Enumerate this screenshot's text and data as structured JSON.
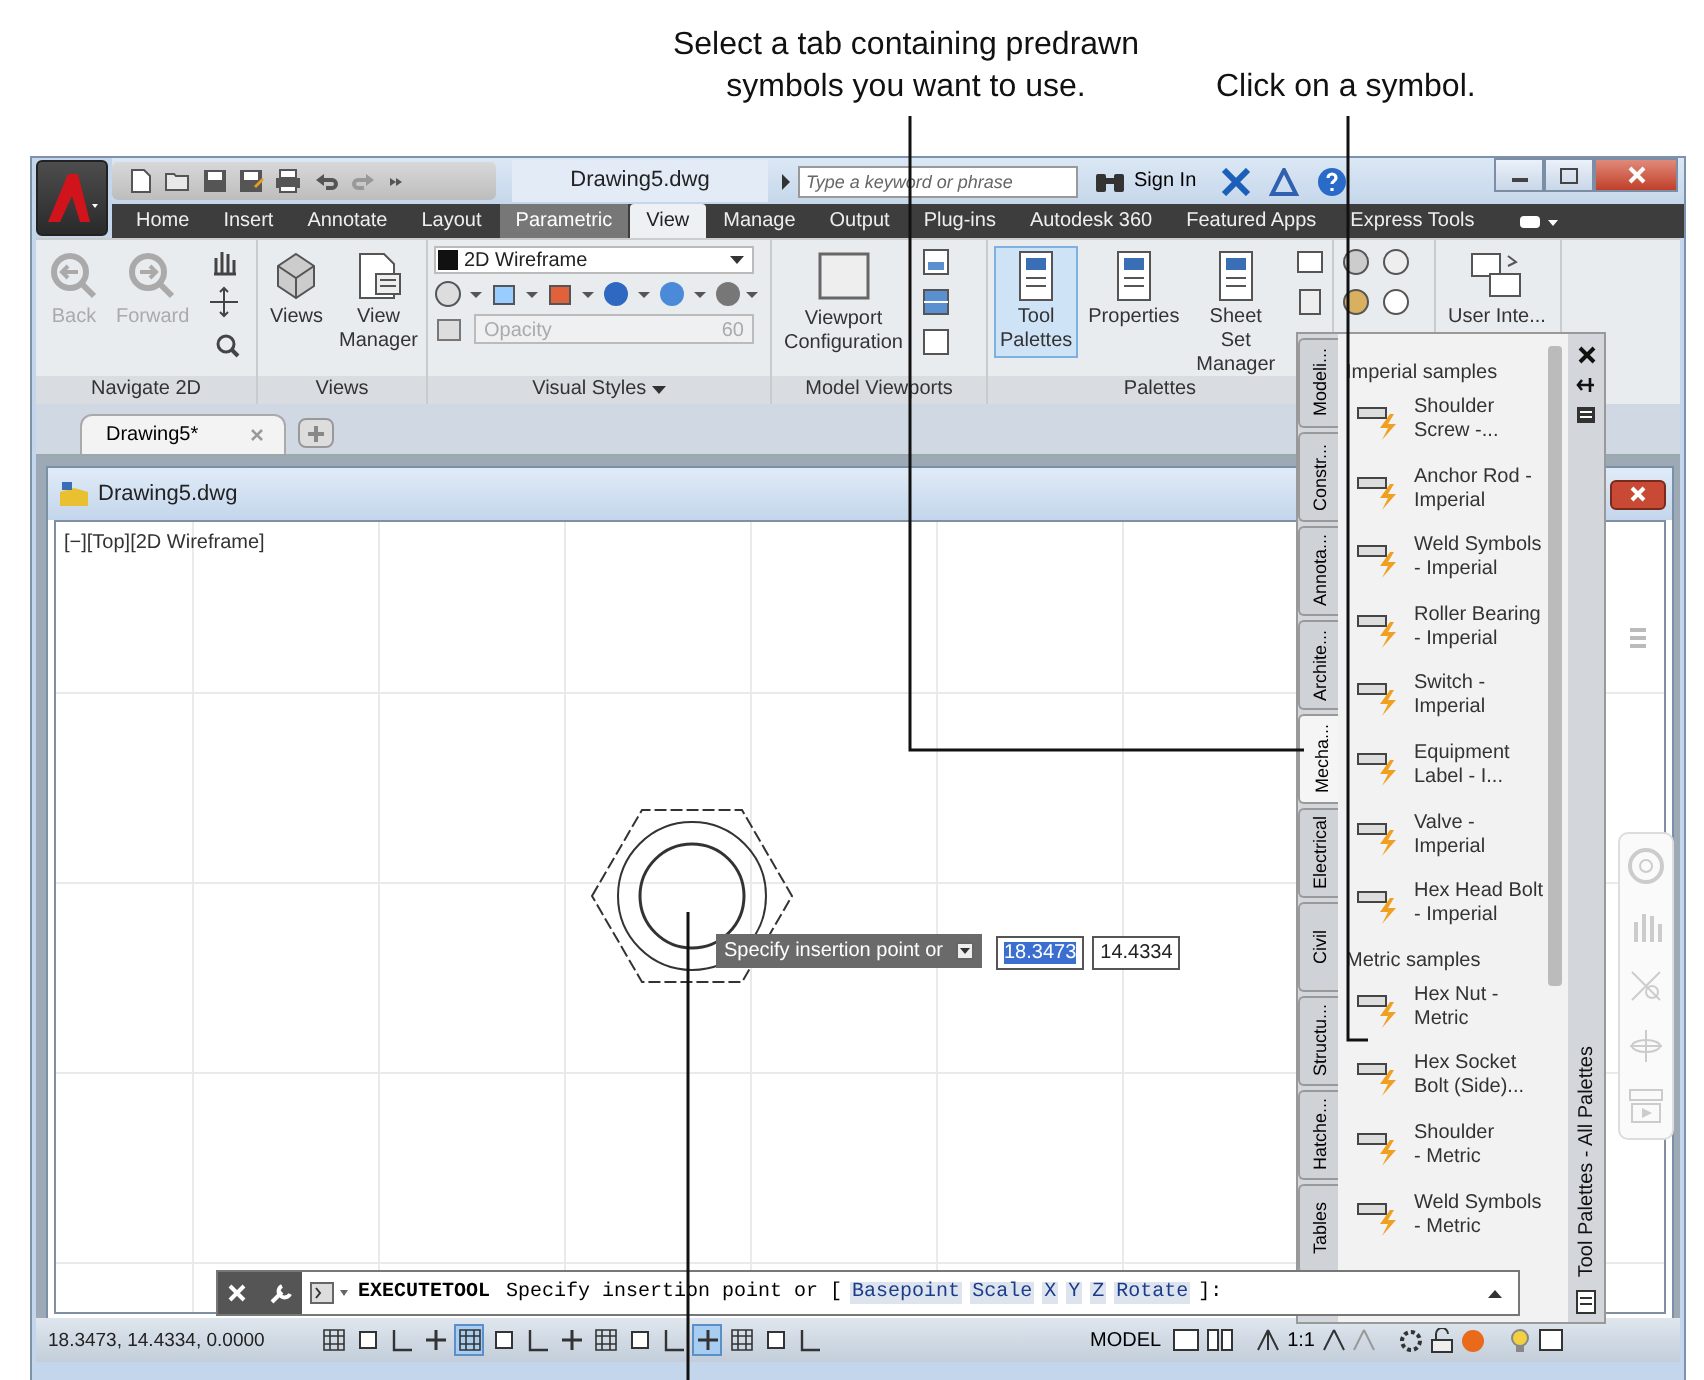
{
  "callouts": [
    {
      "lines": [
        "Select a tab containing predrawn",
        "symbols you want to use."
      ]
    },
    {
      "lines": [
        "Click on a symbol."
      ]
    }
  ],
  "title_bar": {
    "title": "Drawing5.dwg",
    "search": {
      "placeholder": "Type a keyword or phrase"
    },
    "sign_in": "Sign In"
  },
  "ribbon_tabs": [
    {
      "label": "Home",
      "selected": false,
      "hovered": false
    },
    {
      "label": "Insert",
      "selected": false,
      "hovered": false
    },
    {
      "label": "Annotate",
      "selected": false,
      "hovered": false
    },
    {
      "label": "Layout",
      "selected": false,
      "hovered": false
    },
    {
      "label": "Parametric",
      "selected": false,
      "hovered": true
    },
    {
      "label": "View",
      "selected": true,
      "hovered": false
    },
    {
      "label": "Manage",
      "selected": false,
      "hovered": false
    },
    {
      "label": "Output",
      "selected": false,
      "hovered": false
    },
    {
      "label": "Plug-ins",
      "selected": false,
      "hovered": false
    },
    {
      "label": "Autodesk 360",
      "selected": false,
      "hovered": false
    },
    {
      "label": "Featured Apps",
      "selected": false,
      "hovered": false
    },
    {
      "label": "Express Tools",
      "selected": false,
      "hovered": false
    }
  ],
  "ribbon": {
    "navigate": {
      "title": "Navigate 2D",
      "back": {
        "label": "Back",
        "disabled": true
      },
      "forward": {
        "label": "Forward",
        "disabled": true
      }
    },
    "views": {
      "title": "Views",
      "views": "Views",
      "view_manager": "View\nManager"
    },
    "visual_styles": {
      "title": "Visual Styles",
      "style": "2D Wireframe",
      "opacity": {
        "label": "Opacity",
        "value": "60",
        "disabled": true
      }
    },
    "model_viewports": {
      "title": "Model Viewports",
      "configuration": "Viewport\nConfiguration"
    },
    "palettes": {
      "title": "Palettes",
      "buttons": [
        {
          "label": "Tool\nPalettes",
          "selected": true
        },
        {
          "label": "Properties",
          "selected": false
        },
        {
          "label": "Sheet Set\nManager",
          "selected": false
        }
      ]
    },
    "user_interface": {
      "label": "User Inte..."
    }
  },
  "document_tabs": [
    {
      "label": "Drawing5*",
      "selected": true
    }
  ],
  "drawing_window": {
    "title": "Drawing5.dwg",
    "viewport_label": "[−][Top][2D Wireframe]"
  },
  "dynamic_input": {
    "prompt": "Specify insertion point or",
    "fields": [
      {
        "value": "18.3473",
        "selected": true
      },
      {
        "value": "14.4334",
        "selected": false
      }
    ]
  },
  "command_line": {
    "command": "EXECUTETOOL",
    "prompt": "Specify insertion point or [",
    "options": [
      "Basepoint",
      "Scale",
      "X",
      "Y",
      "Z",
      "Rotate"
    ],
    "suffix": "]:"
  },
  "tool_palette": {
    "title": "Tool Palettes - All Palettes",
    "tabs": [
      {
        "label": "Modeli...",
        "selected": false
      },
      {
        "label": "Constr...",
        "selected": false
      },
      {
        "label": "Annota...",
        "selected": false
      },
      {
        "label": "Archite...",
        "selected": false
      },
      {
        "label": "Mecha...",
        "selected": true
      },
      {
        "label": "Electrical",
        "selected": false
      },
      {
        "label": "Civil",
        "selected": false
      },
      {
        "label": "Structu...",
        "selected": false
      },
      {
        "label": "Hatche...",
        "selected": false
      },
      {
        "label": "Tables",
        "selected": false
      }
    ],
    "sections": [
      {
        "title": "Imperial samples",
        "tools": [
          "Shoulder\nScrew -...",
          "Anchor Rod -\nImperial",
          "Weld Symbols\n- Imperial",
          "Roller Bearing\n- Imperial",
          "Switch -\nImperial",
          "Equipment\nLabel - I...",
          "Valve -\nImperial",
          "Hex Head Bolt\n- Imperial"
        ]
      },
      {
        "title": "Metric samples",
        "tools": [
          "Hex Nut -\nMetric",
          "Hex Socket\nBolt (Side)...",
          "Shoulder\n- Metric",
          "Weld Symbols\n- Metric"
        ]
      }
    ]
  },
  "status_bar": {
    "coordinates": "18.3473, 14.4334, 0.0000",
    "toggles": [
      {
        "on": false
      },
      {
        "on": false
      },
      {
        "on": false
      },
      {
        "on": false
      },
      {
        "on": true
      },
      {
        "on": false
      },
      {
        "on": false
      },
      {
        "on": false
      },
      {
        "on": false
      },
      {
        "on": false
      },
      {
        "on": false
      },
      {
        "on": true
      },
      {
        "on": false
      },
      {
        "on": false
      },
      {
        "on": false
      }
    ],
    "model": "MODEL",
    "scale": "1:1"
  }
}
